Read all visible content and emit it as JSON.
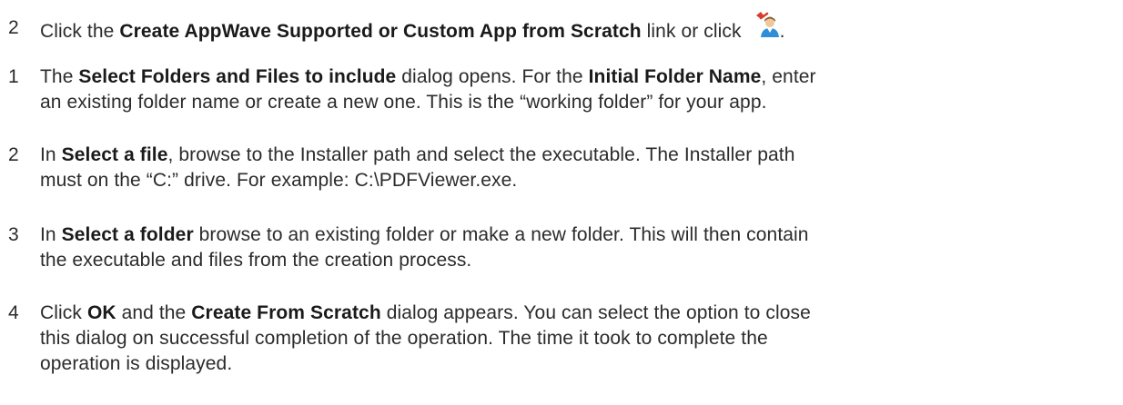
{
  "steps": [
    {
      "number": "2",
      "lines": [
        [
          {
            "t": "Click the ",
            "b": false
          },
          {
            "t": "Create AppWave Supported or Custom App from Scratch",
            "b": true
          },
          {
            "t": " link or click ",
            "b": false
          }
        ]
      ],
      "icon": "create-app-icon",
      "trailing": "."
    },
    {
      "number": "1",
      "lines": [
        [
          {
            "t": "The ",
            "b": false
          },
          {
            "t": "Select Folders and Files to include",
            "b": true
          },
          {
            "t": " dialog opens. For the ",
            "b": false
          },
          {
            "t": "Initial Folder Name",
            "b": true
          },
          {
            "t": ", enter",
            "b": false
          }
        ],
        [
          {
            "t": "an existing folder name or create a new one. This is the “working folder” for your app.",
            "b": false
          }
        ]
      ]
    },
    {
      "number": "2",
      "lines": [
        [
          {
            "t": "In ",
            "b": false
          },
          {
            "t": "Select a file",
            "b": true
          },
          {
            "t": ", browse to the Installer path and select the executable. The Installer path",
            "b": false
          }
        ],
        [
          {
            "t": "must on the “C:” drive. For example: C:\\PDFViewer.exe.",
            "b": false
          }
        ]
      ]
    },
    {
      "number": "3",
      "lines": [
        [
          {
            "t": "In ",
            "b": false
          },
          {
            "t": "Select a folder",
            "b": true
          },
          {
            "t": " browse to an existing folder or make a new folder. This will then contain",
            "b": false
          }
        ],
        [
          {
            "t": "the executable and files from the creation process.",
            "b": false
          }
        ]
      ]
    },
    {
      "number": "4",
      "lines": [
        [
          {
            "t": "Click ",
            "b": false
          },
          {
            "t": "OK",
            "b": true
          },
          {
            "t": " and the ",
            "b": false
          },
          {
            "t": "Create From Scratch",
            "b": true
          },
          {
            "t": " dialog appears. You can select the option to close",
            "b": false
          }
        ],
        [
          {
            "t": "this dialog on successful completion of the operation. The time it took to complete the",
            "b": false
          }
        ],
        [
          {
            "t": "operation is displayed.",
            "b": false
          }
        ]
      ]
    }
  ]
}
